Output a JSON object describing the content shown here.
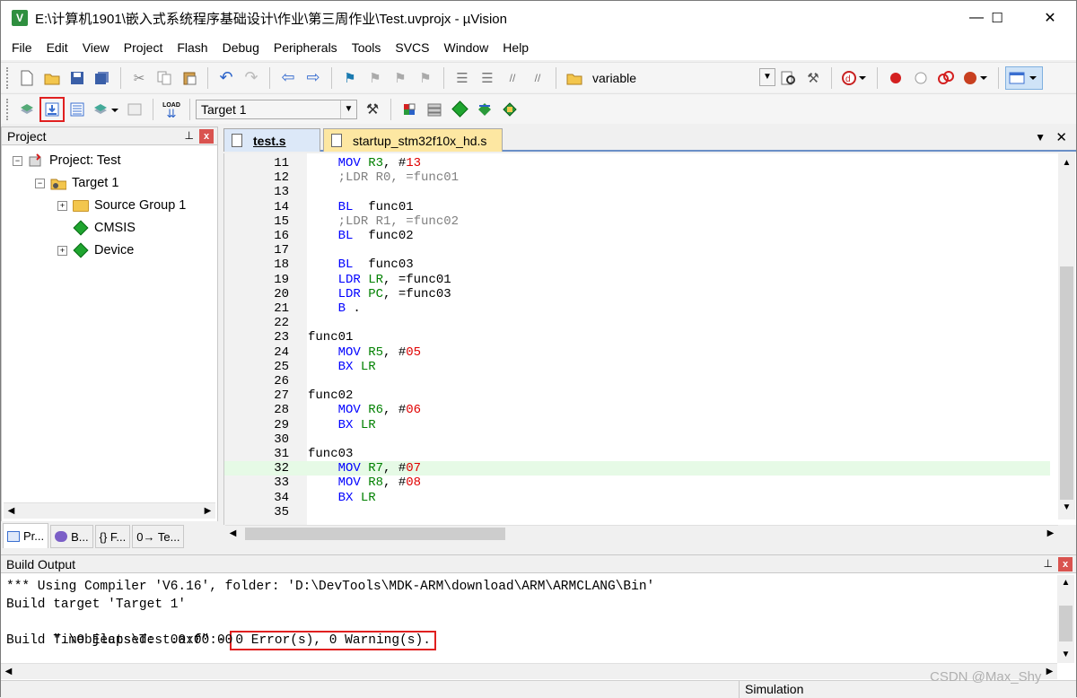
{
  "window": {
    "title": "E:\\计算机1901\\嵌入式系统程序基础设计\\作业\\第三周作业\\Test.uvprojx - µVision",
    "app_icon_label": "V",
    "controls": {
      "minimize": "—",
      "maximize": "☐",
      "close": "✕"
    }
  },
  "menu": [
    "File",
    "Edit",
    "View",
    "Project",
    "Flash",
    "Debug",
    "Peripherals",
    "Tools",
    "SVCS",
    "Window",
    "Help"
  ],
  "toolbar1": {
    "find_value": "variable"
  },
  "toolbar2": {
    "target_value": "Target 1",
    "load_label": "LOAD"
  },
  "project_panel": {
    "title": "Project",
    "pin": "⊥",
    "close": "x",
    "tree": {
      "root": "Project: Test",
      "target": "Target 1",
      "source_group": "Source Group 1",
      "cmsis": "CMSIS",
      "device": "Device"
    },
    "tabs": [
      "Pr...",
      "B...",
      "{} F...",
      "0→ Te..."
    ]
  },
  "editor": {
    "tabs": [
      "test.s",
      "startup_stm32f10x_hd.s"
    ],
    "active_tab_index": 0,
    "highlighted_line": 32,
    "lines": [
      {
        "n": "11",
        "indent": "    ",
        "parts": [
          [
            "kw",
            "MOV"
          ],
          [
            "t",
            " "
          ],
          [
            "reg",
            "R3"
          ],
          [
            "t",
            ", #"
          ],
          [
            "num",
            "13"
          ]
        ]
      },
      {
        "n": "12",
        "indent": "    ",
        "parts": [
          [
            "cm",
            ";LDR R0, =func01"
          ]
        ]
      },
      {
        "n": "13",
        "indent": "",
        "parts": []
      },
      {
        "n": "14",
        "indent": "    ",
        "parts": [
          [
            "kw",
            "BL"
          ],
          [
            "t",
            "  func01"
          ]
        ]
      },
      {
        "n": "15",
        "indent": "    ",
        "parts": [
          [
            "cm",
            ";LDR R1, =func02"
          ]
        ]
      },
      {
        "n": "16",
        "indent": "    ",
        "parts": [
          [
            "kw",
            "BL"
          ],
          [
            "t",
            "  func02"
          ]
        ]
      },
      {
        "n": "17",
        "indent": "",
        "parts": []
      },
      {
        "n": "18",
        "indent": "    ",
        "parts": [
          [
            "kw",
            "BL"
          ],
          [
            "t",
            "  func03"
          ]
        ]
      },
      {
        "n": "19",
        "indent": "    ",
        "parts": [
          [
            "kw",
            "LDR"
          ],
          [
            "t",
            " "
          ],
          [
            "reg",
            "LR"
          ],
          [
            "t",
            ", =func01"
          ]
        ]
      },
      {
        "n": "20",
        "indent": "    ",
        "parts": [
          [
            "kw",
            "LDR"
          ],
          [
            "t",
            " "
          ],
          [
            "reg",
            "PC"
          ],
          [
            "t",
            ", =func03"
          ]
        ]
      },
      {
        "n": "21",
        "indent": "    ",
        "parts": [
          [
            "kw",
            "B"
          ],
          [
            "t",
            " ."
          ]
        ]
      },
      {
        "n": "22",
        "indent": "",
        "parts": []
      },
      {
        "n": "23",
        "indent": "",
        "parts": [
          [
            "t",
            "func01"
          ]
        ]
      },
      {
        "n": "24",
        "indent": "    ",
        "parts": [
          [
            "kw",
            "MOV"
          ],
          [
            "t",
            " "
          ],
          [
            "reg",
            "R5"
          ],
          [
            "t",
            ", #"
          ],
          [
            "num",
            "05"
          ]
        ]
      },
      {
        "n": "25",
        "indent": "    ",
        "parts": [
          [
            "kw",
            "BX"
          ],
          [
            "t",
            " "
          ],
          [
            "reg",
            "LR"
          ]
        ]
      },
      {
        "n": "26",
        "indent": "",
        "parts": []
      },
      {
        "n": "27",
        "indent": "",
        "parts": [
          [
            "t",
            "func02"
          ]
        ]
      },
      {
        "n": "28",
        "indent": "    ",
        "parts": [
          [
            "kw",
            "MOV"
          ],
          [
            "t",
            " "
          ],
          [
            "reg",
            "R6"
          ],
          [
            "t",
            ", #"
          ],
          [
            "num",
            "06"
          ]
        ]
      },
      {
        "n": "29",
        "indent": "    ",
        "parts": [
          [
            "kw",
            "BX"
          ],
          [
            "t",
            " "
          ],
          [
            "reg",
            "LR"
          ]
        ]
      },
      {
        "n": "30",
        "indent": "",
        "parts": []
      },
      {
        "n": "31",
        "indent": "",
        "parts": [
          [
            "t",
            "func03"
          ]
        ]
      },
      {
        "n": "32",
        "indent": "    ",
        "parts": [
          [
            "kw",
            "MOV"
          ],
          [
            "t",
            " "
          ],
          [
            "reg",
            "R7"
          ],
          [
            "t",
            ", #"
          ],
          [
            "num",
            "07"
          ]
        ]
      },
      {
        "n": "33",
        "indent": "    ",
        "parts": [
          [
            "kw",
            "MOV"
          ],
          [
            "t",
            " "
          ],
          [
            "reg",
            "R8"
          ],
          [
            "t",
            ", #"
          ],
          [
            "num",
            "08"
          ]
        ]
      },
      {
        "n": "34",
        "indent": "    ",
        "parts": [
          [
            "kw",
            "BX"
          ],
          [
            "t",
            " "
          ],
          [
            "reg",
            "LR"
          ]
        ]
      },
      {
        "n": "35",
        "indent": "",
        "parts": []
      }
    ]
  },
  "build_output": {
    "title": "Build Output",
    "lines": [
      "*** Using Compiler 'V6.16', folder: 'D:\\DevTools\\MDK-ARM\\download\\ARM\\ARMCLANG\\Bin'",
      "Build target 'Target 1'",
      "\".\\Objects\\Test.axf\" - ",
      "Build Time Elapsed:  00:00:00"
    ],
    "result": "0 Error(s), 0 Warning(s)."
  },
  "status": {
    "mode": "Simulation"
  },
  "watermark": "CSDN @Max_Shy",
  "colors": {
    "keyword": "#0000ff",
    "register": "#008000",
    "number": "#e00000",
    "comment": "#808080",
    "highlight_line": "#e6fae6",
    "annotation_box": "#e02020"
  }
}
